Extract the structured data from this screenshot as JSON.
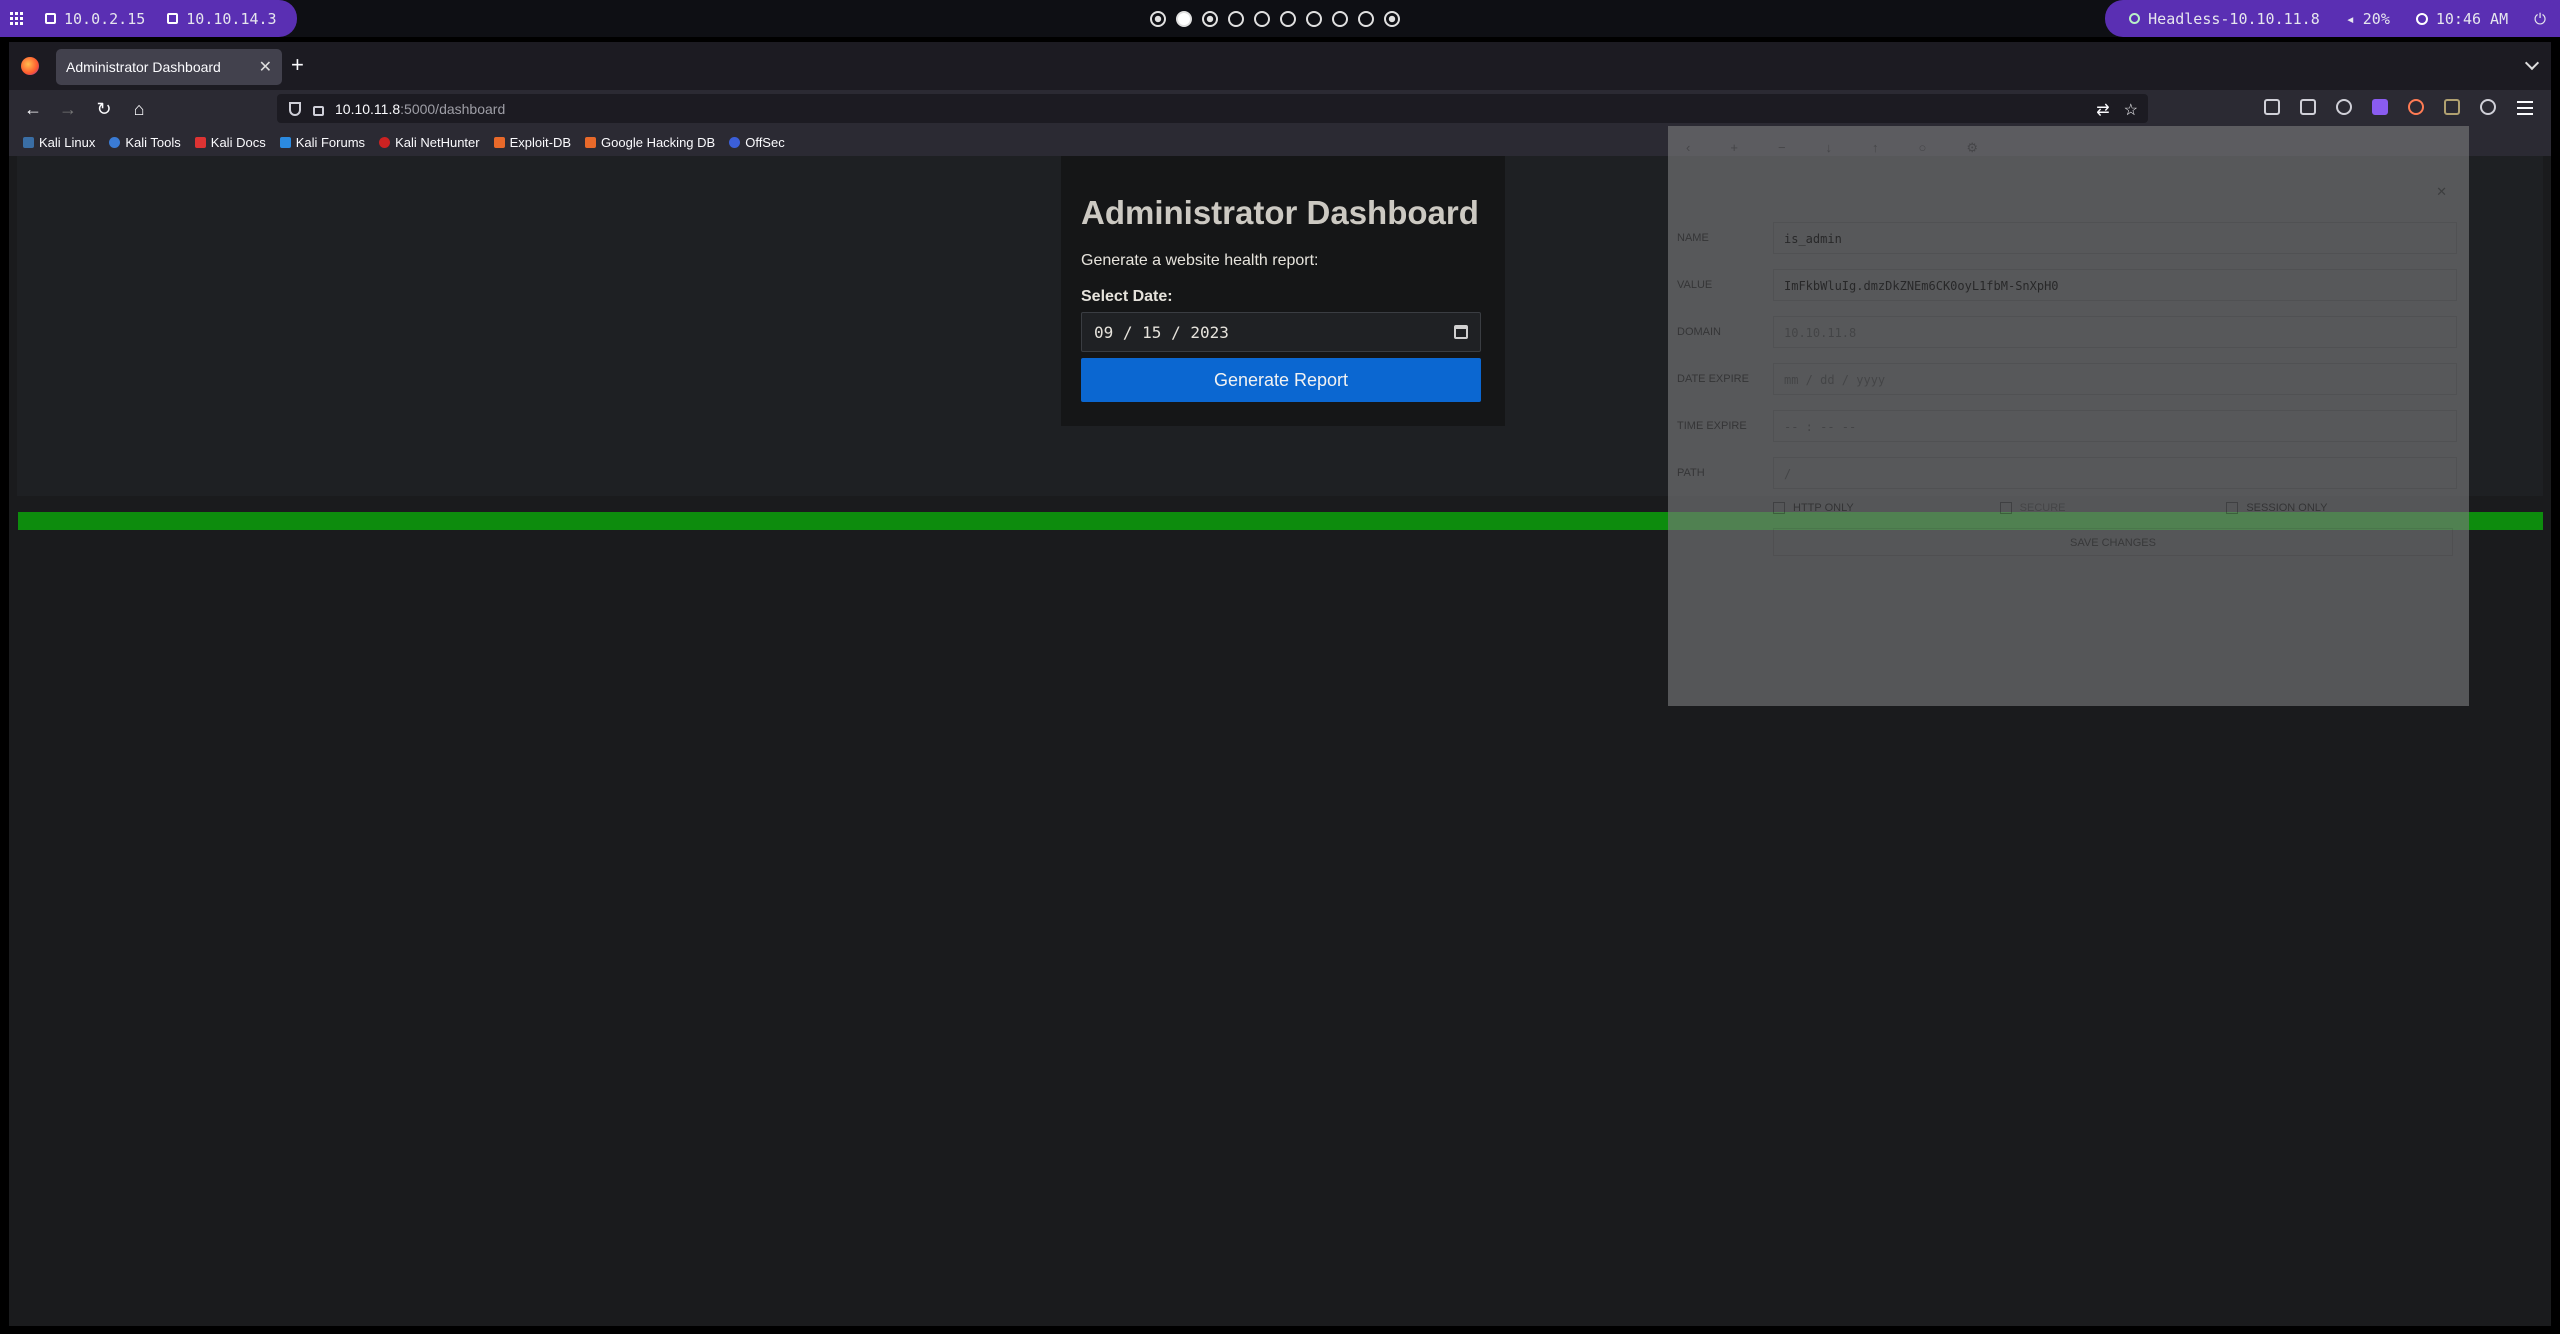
{
  "system_bar": {
    "ip_local": "10.0.2.15",
    "ip_vpn": "10.10.14.3",
    "target": "Headless-10.10.11.8",
    "volume": "20%",
    "time": "10:46 AM"
  },
  "browser": {
    "tab_title": "Administrator Dashboard",
    "url_host": "10.10.11.8",
    "url_path": ":5000/dashboard",
    "bookmarks": [
      "Kali Linux",
      "Kali Tools",
      "Kali Docs",
      "Kali Forums",
      "Kali NetHunter",
      "Exploit-DB",
      "Google Hacking DB",
      "OffSec"
    ]
  },
  "dashboard": {
    "title": "Administrator Dashboard",
    "description": "Generate a website health report:",
    "date_label": "Select Date:",
    "date_value": "09 / 15 / 2023",
    "button_label": "Generate Report"
  },
  "cookie_editor": {
    "rows": [
      {
        "label": "NAME",
        "value": "is_admin"
      },
      {
        "label": "VALUE",
        "value": "ImFkbWluIg.dmzDkZNEm6CK0oyL1fbM-SnXpH0"
      },
      {
        "label": "DOMAIN",
        "value": "10.10.11.8"
      },
      {
        "label": "DATE EXPIRE",
        "value": "mm / dd / yyyy"
      },
      {
        "label": "TIME EXPIRE",
        "value": "-- : -- --"
      },
      {
        "label": "PATH",
        "value": "/"
      }
    ],
    "http_only": "HTTP ONLY",
    "secure": "SECURE",
    "session_only": "SESSION ONLY",
    "save": "SAVE CHANGES"
  },
  "colors": {
    "accent": "#0b67d1",
    "progress": "#0d8c0d",
    "panel": "#5a2fb3"
  }
}
